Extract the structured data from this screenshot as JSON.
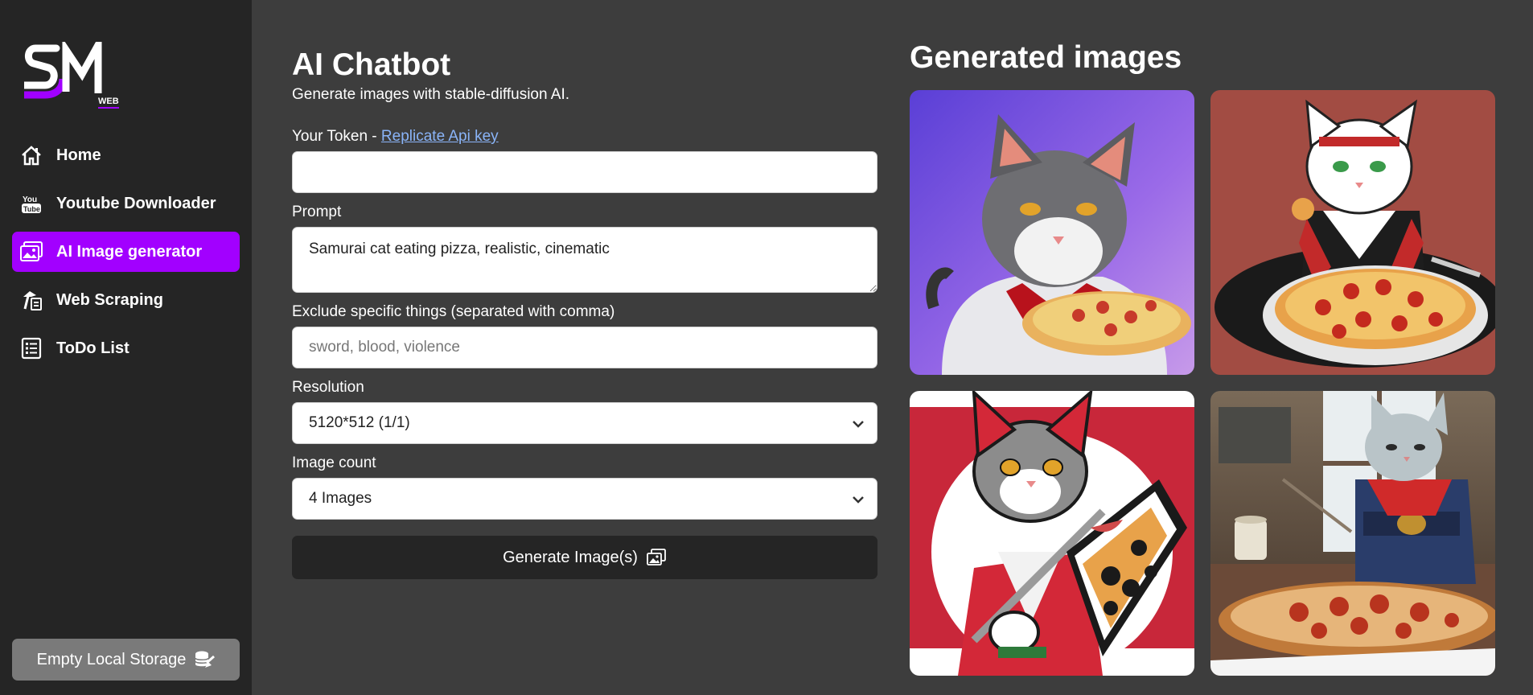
{
  "sidebar": {
    "logo_text": "WEB",
    "items": [
      {
        "label": "Home",
        "icon": "home-icon",
        "active": false
      },
      {
        "label": "Youtube Downloader",
        "icon": "youtube-icon",
        "active": false
      },
      {
        "label": "AI Image generator",
        "icon": "image-icon",
        "active": true
      },
      {
        "label": "Web Scraping",
        "icon": "scraping-icon",
        "active": false
      },
      {
        "label": "ToDo List",
        "icon": "list-icon",
        "active": false
      }
    ],
    "storage_button": "Empty Local Storage"
  },
  "form": {
    "title": "AI Chatbot",
    "subtitle": "Generate images with stable-diffusion AI.",
    "token_label": "Your Token - ",
    "token_link": "Replicate Api key",
    "token_value": "",
    "prompt_label": "Prompt",
    "prompt_value": "Samurai cat eating pizza, realistic, cinematic",
    "exclude_label": "Exclude specific things (separated with comma)",
    "exclude_placeholder": "sword, blood, violence",
    "resolution_label": "Resolution",
    "resolution_value": "5120*512 (1/1)",
    "count_label": "Image count",
    "count_value": "4 Images",
    "generate_button": "Generate Image(s)"
  },
  "gallery": {
    "title": "Generated images",
    "images": [
      {
        "name": "generated-image-1"
      },
      {
        "name": "generated-image-2"
      },
      {
        "name": "generated-image-3"
      },
      {
        "name": "generated-image-4"
      }
    ]
  },
  "colors": {
    "accent": "#a200ff",
    "sidebar_bg": "#252525",
    "page_bg": "#3d3d3d",
    "link": "#8ab4f8"
  }
}
